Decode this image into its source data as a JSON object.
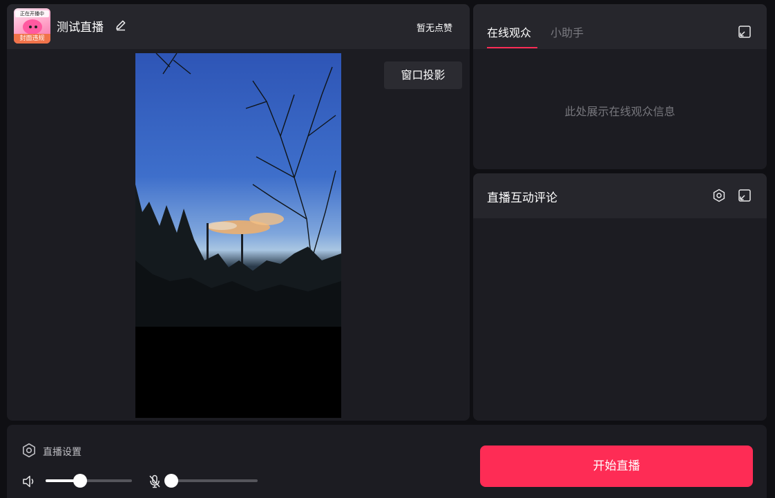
{
  "stream": {
    "title": "测试直播",
    "likes_text": "暂无点赞",
    "cover": {
      "top_text": "正在开播中",
      "badge": "封面违规"
    },
    "window_projection_label": "窗口投影"
  },
  "audience": {
    "tabs": [
      {
        "label": "在线观众",
        "active": true
      },
      {
        "label": "小助手",
        "active": false
      }
    ],
    "empty_text": "此处展示在线观众信息"
  },
  "comments": {
    "title": "直播互动评论"
  },
  "bottom": {
    "settings_label": "直播设置",
    "volume_level": 0.4,
    "mic_level": 0.0,
    "start_button": "开始直播"
  },
  "colors": {
    "accent": "#fe2c55",
    "panel": "#1c1c22",
    "header": "#26262c",
    "background": "#0f0f13"
  },
  "icons": [
    "edit-icon",
    "popout-icon",
    "gear-icon",
    "speaker-icon",
    "mic-off-icon"
  ]
}
